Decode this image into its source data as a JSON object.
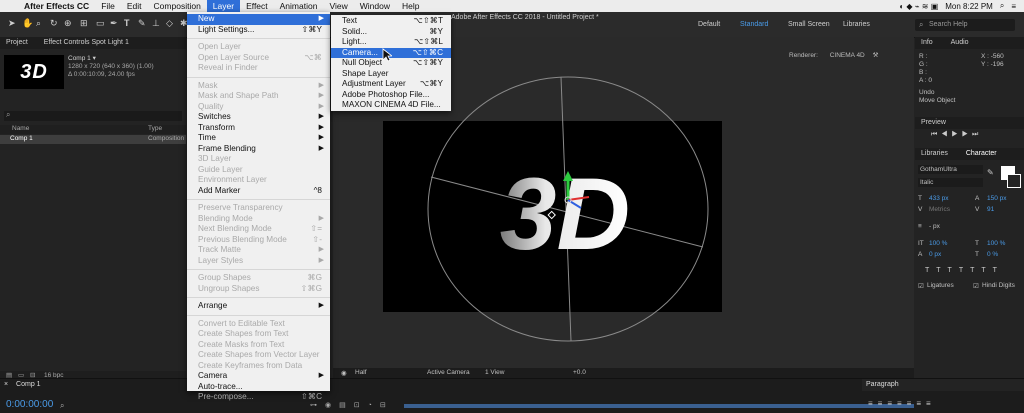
{
  "menubar": {
    "apple": "",
    "items": [
      "After Effects CC",
      "File",
      "Edit",
      "Composition",
      "Layer",
      "Effect",
      "Animation",
      "View",
      "Window",
      "Help"
    ],
    "active": "Layer",
    "clock": "Mon 8:22 PM"
  },
  "window_title": "Adobe After Effects CC 2018 - Untitled Project *",
  "toolbar": {
    "workspaces": [
      "Default",
      "Standard",
      "Small Screen",
      "Libraries"
    ],
    "active_workspace": "Standard",
    "search_placeholder": "Search Help"
  },
  "project_panel": {
    "tab": "Project",
    "effect_controls_tab": "Effect Controls Spot Light 1",
    "thumb_text": "3D",
    "comp_name": "Comp 1 ▾",
    "comp_info_1": "1280 x 720  (640 x 360) (1.00)",
    "comp_info_2": "Δ 0:00:10:09, 24.00 fps",
    "col_name": "Name",
    "col_type": "Type",
    "row_name": "Comp 1",
    "row_type": "Composition",
    "bpc": "16 bpc"
  },
  "layer_menu": [
    {
      "label": "New",
      "hl": true,
      "arrow": true
    },
    {
      "label": "Light Settings...",
      "sc": "⇧⌘Y"
    },
    {
      "sep": true
    },
    {
      "label": "Open Layer",
      "dis": true
    },
    {
      "label": "Open Layer Source",
      "dis": true,
      "sc": "⌥⌘"
    },
    {
      "label": "Reveal in Finder",
      "dis": true
    },
    {
      "sep": true
    },
    {
      "label": "Mask",
      "dis": true,
      "arrow": true
    },
    {
      "label": "Mask and Shape Path",
      "dis": true,
      "arrow": true
    },
    {
      "label": "Quality",
      "dis": true,
      "arrow": true
    },
    {
      "label": "Switches",
      "arrow": true
    },
    {
      "label": "Transform",
      "arrow": true
    },
    {
      "label": "Time",
      "arrow": true
    },
    {
      "label": "Frame Blending",
      "arrow": true
    },
    {
      "label": "3D Layer",
      "dis": true
    },
    {
      "label": "Guide Layer",
      "dis": true
    },
    {
      "label": "Environment Layer",
      "dis": true
    },
    {
      "label": "Add Marker",
      "sc": "^8"
    },
    {
      "sep": true
    },
    {
      "label": "Preserve Transparency",
      "dis": true
    },
    {
      "label": "Blending Mode",
      "dis": true,
      "arrow": true
    },
    {
      "label": "Next Blending Mode",
      "dis": true,
      "sc": "⇧="
    },
    {
      "label": "Previous Blending Mode",
      "dis": true,
      "sc": "⇧-"
    },
    {
      "label": "Track Matte",
      "dis": true,
      "arrow": true
    },
    {
      "label": "Layer Styles",
      "dis": true,
      "arrow": true
    },
    {
      "sep": true
    },
    {
      "label": "Group Shapes",
      "dis": true,
      "sc": "⌘G"
    },
    {
      "label": "Ungroup Shapes",
      "dis": true,
      "sc": "⇧⌘G"
    },
    {
      "sep": true
    },
    {
      "label": "Arrange",
      "arrow": true
    },
    {
      "sep": true
    },
    {
      "label": "Convert to Editable Text",
      "dis": true
    },
    {
      "label": "Create Shapes from Text",
      "dis": true
    },
    {
      "label": "Create Masks from Text",
      "dis": true
    },
    {
      "label": "Create Shapes from Vector Layer",
      "dis": true
    },
    {
      "label": "Create Keyframes from Data",
      "dis": true
    },
    {
      "label": "Camera",
      "arrow": true
    },
    {
      "label": "Auto-trace..."
    },
    {
      "label": "Pre-compose...",
      "dis": true,
      "sc": "⇧⌘C"
    }
  ],
  "new_submenu": [
    {
      "label": "Text",
      "sc": "⌥⇧⌘T"
    },
    {
      "label": "Solid...",
      "sc": "⌘Y"
    },
    {
      "label": "Light...",
      "sc": "⌥⇧⌘L"
    },
    {
      "label": "Camera...",
      "sc": "⌥⇧⌘C",
      "hl": true
    },
    {
      "label": "Null Object",
      "sc": "⌥⇧⌘Y"
    },
    {
      "label": "Shape Layer"
    },
    {
      "label": "Adjustment Layer",
      "sc": "⌥⌘Y"
    },
    {
      "label": "Adobe Photoshop File..."
    },
    {
      "label": "MAXON CINEMA 4D File..."
    }
  ],
  "viewer": {
    "renderer_label": "Renderer:",
    "renderer_value": "CINEMA 4D",
    "comp_text": "3D",
    "footer_res": "Half",
    "footer_camera": "Active Camera",
    "footer_view": "1 View",
    "footer_exposure": "+0.0"
  },
  "info_panel": {
    "tab": "Info",
    "tab2": "Audio",
    "r": "R :",
    "g": "G :",
    "b": "B :",
    "a": "A : 0",
    "x": "X : -560",
    "y": "Y : -196",
    "undo": "Undo",
    "undo_action": "Move Object"
  },
  "preview_panel": {
    "tab": "Preview"
  },
  "character_panel": {
    "tab_libraries": "Libraries",
    "tab_character": "Character",
    "font": "GothamUltra",
    "style": "Italic",
    "size": "433 px",
    "leading": "150 px",
    "kerning": "Metrics",
    "tracking": "91",
    "stroke": "- px",
    "vscale": "100 %",
    "hscale": "100 %",
    "baseline": "0 px",
    "tsume": "0 %",
    "ligatures": "Ligatures",
    "hindi": "Hindi Digits"
  },
  "paragraph_panel": {
    "tab": "Paragraph"
  },
  "timeline": {
    "tab": "Comp 1",
    "timecode": "0:00:00:00"
  }
}
